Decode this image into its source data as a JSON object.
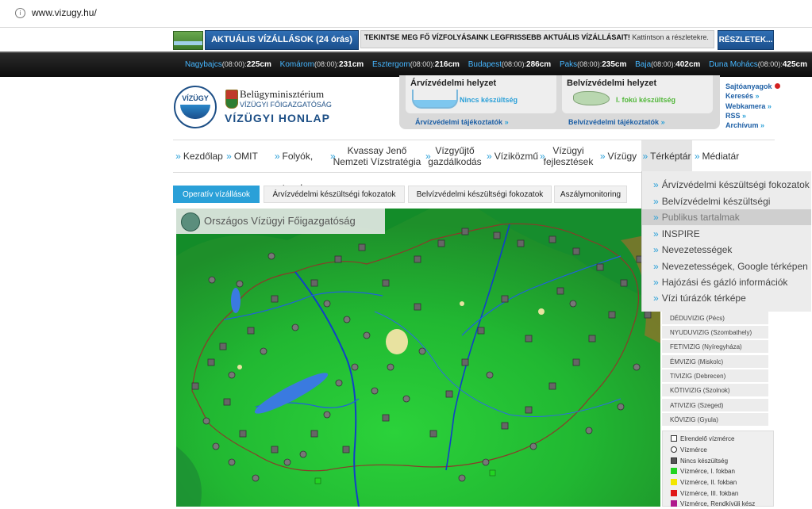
{
  "browser": {
    "url": "www.vizugy.hu/"
  },
  "banner": {
    "aktualis_label": "AKTUÁLIS VÍZÁLLÁSOK (24 órás)",
    "notice_bold": "TEKINTSE MEG FŐ VÍZFOLYÁSAINK LEGFRISSEBB AKTUÁLIS VÍZÁLLÁSAIT!",
    "notice_rest": " Kattintson a részletekre.",
    "reszletek_label": "RÉSZLETEK..."
  },
  "ticker": [
    {
      "station": "Nagybajcs",
      "time": "(08:00):",
      "level": "225cm"
    },
    {
      "station": "Komárom",
      "time": "(08:00):",
      "level": "231cm"
    },
    {
      "station": "Esztergom",
      "time": "(08:00):",
      "level": "216cm"
    },
    {
      "station": "Budapest",
      "time": "(08:00):",
      "level": "286cm"
    },
    {
      "station": "Paks",
      "time": "(08:00):",
      "level": "235cm"
    },
    {
      "station": "Baja",
      "time": "(08:00):",
      "level": "402cm"
    },
    {
      "station": "Duna Mohács",
      "time": "(08:00):",
      "level": "425cm"
    }
  ],
  "header": {
    "logo_text": "VÍZÜGY",
    "ministry": "Belügyminisztérium",
    "directorate": "VÍZÜGYI FŐIGAZGATÓSÁG",
    "site_name": "VÍZÜGYI HONLAP"
  },
  "panels": {
    "flood_title": "Árvízvédelmi helyzet",
    "flood_status": "Nincs készültség",
    "flood_link": "Árvízvédelmi tájékoztatók",
    "inland_title": "Belvízvédelmi helyzet",
    "inland_status": "I. fokú készültség",
    "inland_link": "Belvízvédelmi tájékoztatók"
  },
  "quick_links": [
    "Sajtóanyagok",
    "Keresés",
    "Webkamera",
    "RSS",
    "Archívum"
  ],
  "nav": {
    "items": [
      {
        "label": "Kezdőlap"
      },
      {
        "label": "OMIT"
      },
      {
        "label": "Folyók, tavak"
      },
      {
        "label1": "Kvassay Jenő",
        "label2": "Nemzeti Vízstratégia"
      },
      {
        "label1": "Vízgyűjtő",
        "label2": "gazdálkodás"
      },
      {
        "label": "Víziközmű"
      },
      {
        "label1": "Vízügyi",
        "label2": "fejlesztések"
      },
      {
        "label": "Vízügy"
      },
      {
        "label": "Térképtár"
      },
      {
        "label": "Médiatár"
      }
    ],
    "dropdown": [
      "Árvízvédelmi készültségi fokozatok",
      "Belvízvédelmi készültségi fokozatok",
      "Publikus tartalmak",
      "INSPIRE",
      "Nevezetességek",
      "Nevezetességek, Google térképen",
      "Hajózási és gázló információk",
      "Vízi túrázók térképe"
    ]
  },
  "tabs": [
    "Operatív vízállások",
    "Árvízvédelmi készültségi fokozatok",
    "Belvízvédelmi készültségi fokozatok",
    "Aszálymonitoring"
  ],
  "map": {
    "title": "Országos Vízügyi Főigazgatóság"
  },
  "vizig": [
    "DÉDUVIZIG (Pécs)",
    "NYUDUVIZIG (Szombathely)",
    "FETIVIZIG (Nyíregyháza)",
    "ÉMVIZIG (Miskolc)",
    "TIVIZIG (Debrecen)",
    "KÖTIVIZIG (Szolnok)",
    "ATIVIZIG (Szeged)",
    "KÖVIZIG (Gyula)"
  ],
  "legend": [
    {
      "label": "Elrendelő vízmérce",
      "color": "#ffffff",
      "shape": "square"
    },
    {
      "label": "Vízmérce",
      "color": "#ffffff",
      "shape": "circle"
    },
    {
      "label": "Nincs készültség",
      "color": "#555555",
      "shape": "square"
    },
    {
      "label": "Vízmérce, I. fokban",
      "color": "#22d422",
      "shape": "square"
    },
    {
      "label": "Vízmérce, II. fokban",
      "color": "#f2e600",
      "shape": "square"
    },
    {
      "label": "Vízmérce, III. fokban",
      "color": "#e01818",
      "shape": "square"
    },
    {
      "label": "Vízmérce, Rendkívüli kész",
      "color": "#b0188c",
      "shape": "square"
    }
  ]
}
